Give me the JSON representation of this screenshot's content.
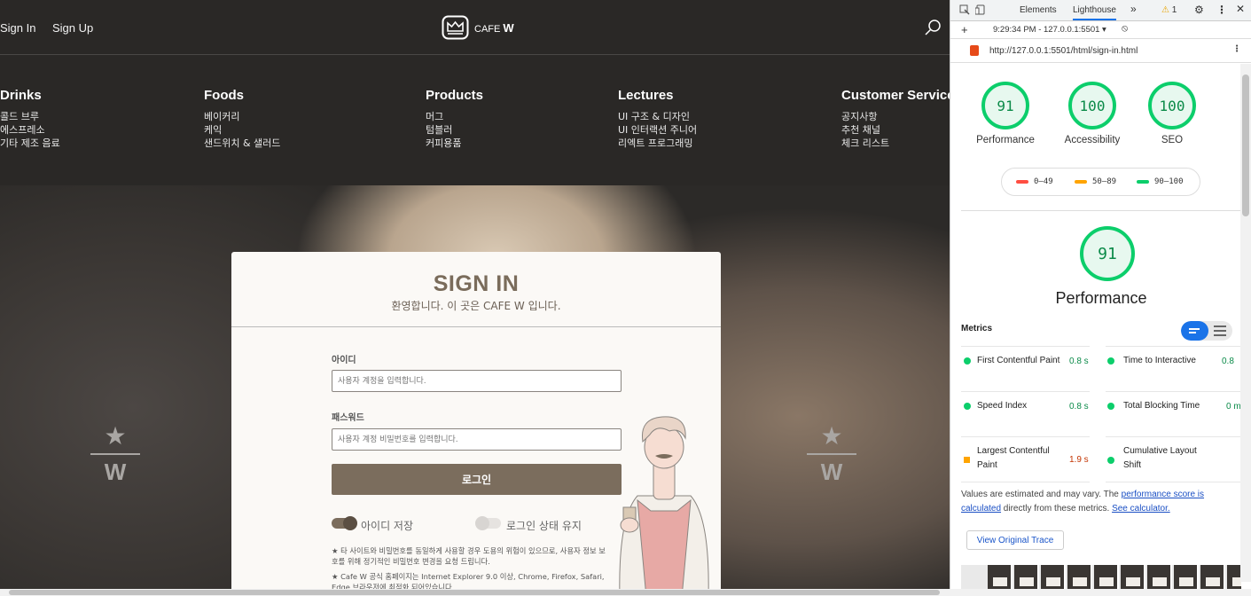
{
  "site": {
    "top_links": {
      "signin": "Sign In",
      "signup": "Sign Up"
    },
    "logo_text": "CAFE",
    "logo_bold": "W",
    "menu": [
      {
        "title": "Drinks",
        "items": [
          "콜드 브루",
          "에스프레소",
          "기타 제조 음료"
        ]
      },
      {
        "title": "Foods",
        "items": [
          "베이커리",
          "케익",
          "샌드위치 & 샐러드"
        ]
      },
      {
        "title": "Products",
        "items": [
          "머그",
          "텀블러",
          "커피용품"
        ]
      },
      {
        "title": "Lectures",
        "items": [
          "UI 구조 & 디자인",
          "UI 인터랙션 주니어",
          "리엑트 프로그래밍"
        ]
      },
      {
        "title": "Customer Service",
        "items": [
          "공지사항",
          "추천 채널",
          "체크 리스트"
        ]
      }
    ],
    "hero_mark": {
      "star": "★",
      "letter": "W"
    },
    "signin": {
      "title": "SIGN IN",
      "subtitle": "환영합니다. 이 곳은 CAFE W 입니다.",
      "id_label": "아이디",
      "id_placeholder": "사용자 계정을 입력합니다.",
      "pw_label": "패스워드",
      "pw_placeholder": "사용자 계정 비밀번호를 입력합니다.",
      "login_button": "로그인",
      "toggle_save_id": {
        "label": "아이디 저장",
        "on": true
      },
      "toggle_keep_login": {
        "label": "로그인 상태 유지",
        "on": false
      },
      "notes": [
        "★ 타 사이트와 비밀번호를 동일하게 사용할 경우 도용의 위험이 있으므로, 사용자 정보 보호를 위해 정기적인 비밀번호 변경을 요청 드립니다.",
        "★ Cafe W 공식 홈페이지는 Internet Explorer 9.0 이상, Chrome, Firefox, Safari, Edge 브라우저에 최적화 되어있습니다."
      ]
    }
  },
  "devtools": {
    "tabs": {
      "elements": "Elements",
      "lighthouse": "Lighthouse",
      "more": "»"
    },
    "warning_count": "1",
    "report_select": "9:29:34 PM - 127.0.0.1:5501",
    "url": "http://127.0.0.1:5501/html/sign-in.html",
    "gauges": [
      {
        "label": "Performance",
        "score": "91"
      },
      {
        "label": "Accessibility",
        "score": "100"
      },
      {
        "label": "SEO",
        "score": "100"
      }
    ],
    "legend": [
      {
        "range": "0–49",
        "color": "#ff4e42"
      },
      {
        "range": "50–89",
        "color": "#ffa400"
      },
      {
        "range": "90–100",
        "color": "#0cce6b"
      }
    ],
    "category_score": "91",
    "category_label": "Performance",
    "metrics_heading": "Metrics",
    "metrics": {
      "fcp": {
        "label": "First Contentful Paint",
        "value": "0.8 s"
      },
      "tti": {
        "label": "Time to Interactive",
        "value": "0.8"
      },
      "si": {
        "label": "Speed Index",
        "value": "0.8 s"
      },
      "tbt": {
        "label": "Total Blocking Time",
        "value": "0 m"
      },
      "lcp": {
        "label1": "Largest Contentful",
        "label2": "Paint",
        "value": "1.9 s"
      },
      "cls": {
        "label1": "Cumulative Layout",
        "label2": "Shift"
      }
    },
    "note": {
      "pre": "Values are estimated and may vary. The ",
      "link1": "performance score is calculated",
      "mid": " directly from these metrics. ",
      "link2": "See calculator."
    },
    "trace_button": "View Original Trace"
  }
}
